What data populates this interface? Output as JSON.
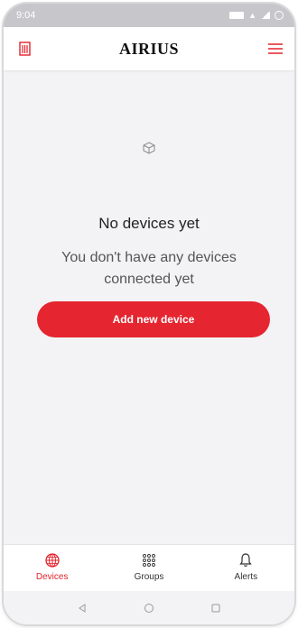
{
  "status_bar": {
    "time": "9:04",
    "icons": [
      "battery-icon",
      "wifi-icon",
      "signal-icon",
      "ring-icon"
    ]
  },
  "app_bar": {
    "left_icon": "building-icon",
    "logo_text": "AIRIUS",
    "right_icon": "menu-icon"
  },
  "empty_state": {
    "icon": "box-icon",
    "title": "No devices yet",
    "description": "You don't have any devices connected yet",
    "button_label": "Add new device"
  },
  "bottom_nav": {
    "items": [
      {
        "label": "Devices",
        "icon": "devices-icon",
        "active": true
      },
      {
        "label": "Groups",
        "icon": "groups-grid-icon",
        "active": false
      },
      {
        "label": "Alerts",
        "icon": "bell-icon",
        "active": false
      }
    ]
  },
  "system_nav": {
    "icons": [
      "back-icon",
      "home-icon",
      "recents-icon"
    ]
  },
  "colors": {
    "accent": "#e3222b",
    "button": "#e5252f",
    "background": "#f3f3f5",
    "status_bar": "#c7c7cb"
  }
}
